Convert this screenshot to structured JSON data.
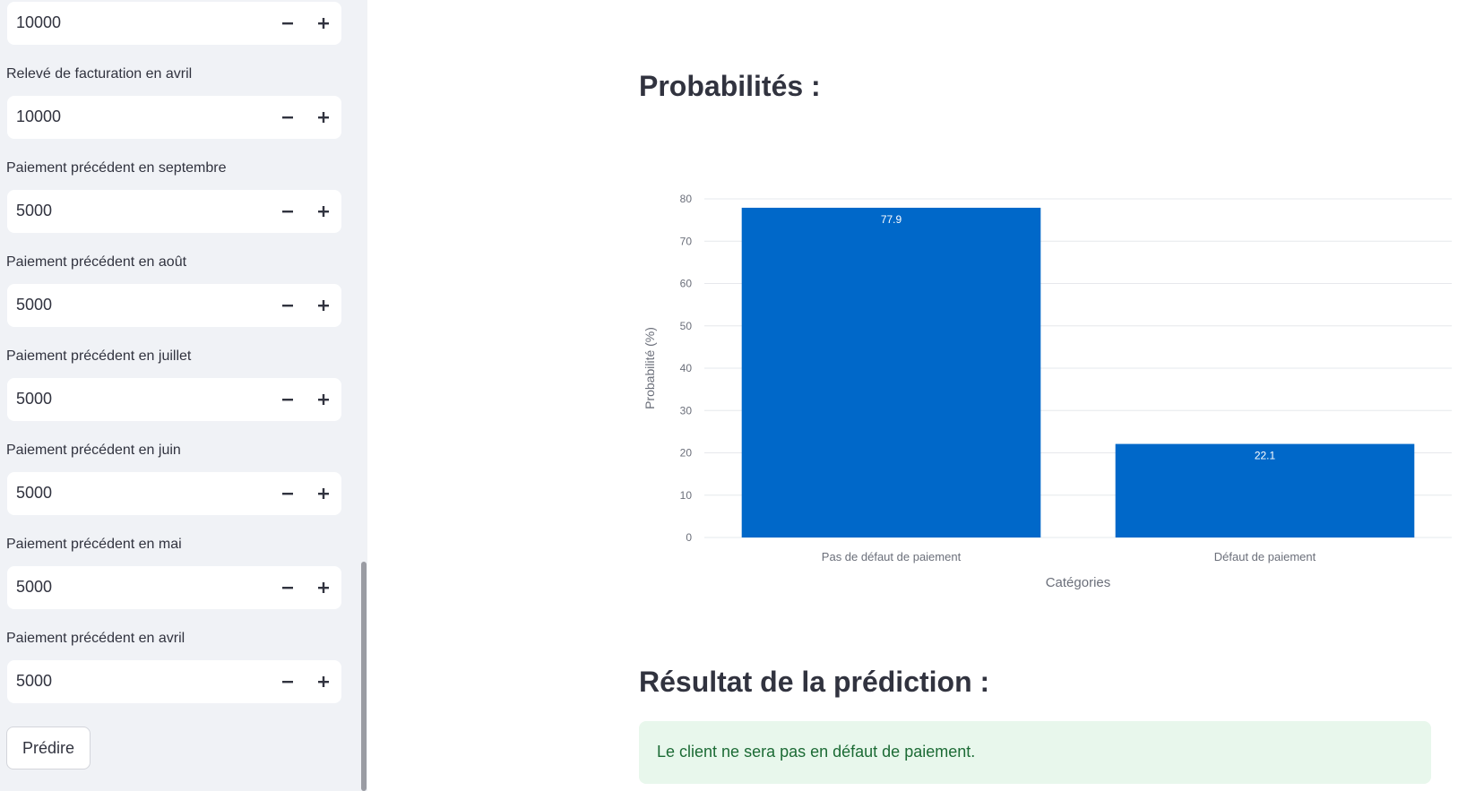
{
  "sidebar": {
    "fields": [
      {
        "label": "",
        "value": "10000"
      },
      {
        "label": "Relevé de facturation en avril",
        "value": "10000"
      },
      {
        "label": "Paiement précédent en septembre",
        "value": "5000"
      },
      {
        "label": "Paiement précédent en août",
        "value": "5000"
      },
      {
        "label": "Paiement précédent en juillet",
        "value": "5000"
      },
      {
        "label": "Paiement précédent en juin",
        "value": "5000"
      },
      {
        "label": "Paiement précédent en mai",
        "value": "5000"
      },
      {
        "label": "Paiement précédent en avril",
        "value": "5000"
      }
    ],
    "predict_label": "Prédire"
  },
  "main": {
    "prob_heading": "Probabilités :",
    "result_heading": "Résultat de la prédiction :",
    "result_text": "Le client ne sera pas en défaut de paiement."
  },
  "chart_data": {
    "type": "bar",
    "categories": [
      "Pas de défaut de paiement",
      "Défaut de paiement"
    ],
    "values": [
      77.9,
      22.1
    ],
    "data_labels": [
      "77.9",
      "22.1"
    ],
    "xlabel": "Catégories",
    "ylabel": "Probabilité (%)",
    "ylim": [
      0,
      80
    ],
    "yticks": [
      0,
      10,
      20,
      30,
      40,
      50,
      60,
      70,
      80
    ],
    "grid": true,
    "bar_color": "#0068c9"
  },
  "colors": {
    "sidebar_bg": "#f0f2f6",
    "success_bg": "#e8f7ec",
    "success_text": "#1c6b35"
  }
}
